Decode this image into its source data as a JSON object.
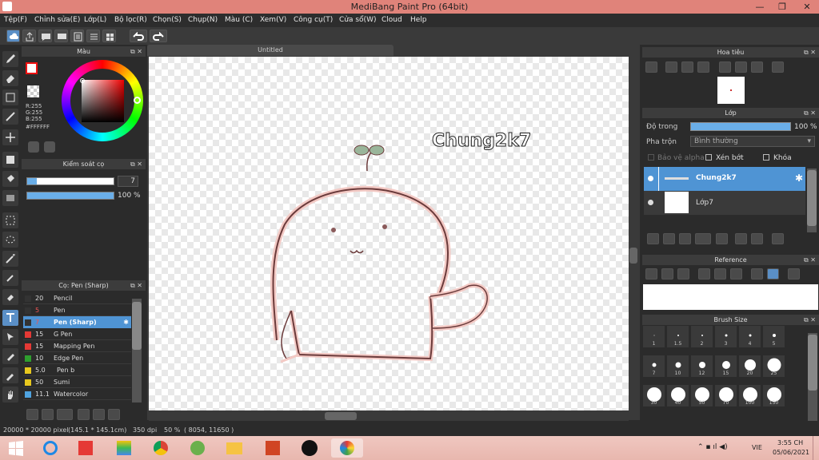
{
  "window": {
    "title": "MediBang Paint Pro (64bit)"
  },
  "menu": [
    "Tệp(F)",
    "Chỉnh sửa(E)",
    "Lớp(L)",
    "Bộ lọc(R)",
    "Chọn(S)",
    "Chụp(N)",
    "Màu (C)",
    "Xem(V)",
    "Công cụ(T)",
    "Cửa sổ(W)",
    "Cloud",
    "Help"
  ],
  "color_panel": {
    "title": "Màu",
    "r": "R:255",
    "g": "G:255",
    "b": "B:255",
    "hex": "#FFFFFF"
  },
  "brush_control": {
    "title": "Kiểm soát cọ",
    "size": "7",
    "opacity": "100 %"
  },
  "brush_list": {
    "title": "Cọ: Pen (Sharp)",
    "items": [
      {
        "size": "20",
        "name": "Pencil",
        "color": "#333333"
      },
      {
        "size": "5",
        "name": "Pen",
        "color": "#333333"
      },
      {
        "size": "7",
        "name": "Pen (Sharp)",
        "color": "#333333"
      },
      {
        "size": "15",
        "name": "G Pen",
        "color": "#e53935"
      },
      {
        "size": "15",
        "name": "Mapping Pen",
        "color": "#e53935"
      },
      {
        "size": "10",
        "name": "Edge Pen",
        "color": "#2e9e2e"
      },
      {
        "size": "5.0",
        "name": "Pen b",
        "color": "#e8c81e"
      },
      {
        "size": "50",
        "name": "Sumi",
        "color": "#e8c81e"
      },
      {
        "size": "11.1",
        "name": "Watercolor",
        "color": "#4fa3e0"
      }
    ]
  },
  "document": {
    "tab": "Untitled",
    "canvas_text": "Chung2k7"
  },
  "navigator": {
    "title": "Hoa tiêu"
  },
  "layer_panel": {
    "title": "Lớp",
    "opacity_label": "Độ trong",
    "opacity_value": "100 %",
    "blend_label": "Pha trộn",
    "blend_value": "Bình thường",
    "protect_alpha": "Bảo vệ alpha",
    "clipping": "Xén bớt",
    "lock": "Khóa",
    "layers": [
      {
        "name": "Chung2k7",
        "selected": true
      },
      {
        "name": "Lớp7",
        "selected": false
      }
    ]
  },
  "reference": {
    "title": "Reference"
  },
  "brush_size": {
    "title": "Brush Size",
    "sizes": [
      "1",
      "1.5",
      "2",
      "3",
      "4",
      "5",
      "7",
      "10",
      "12",
      "15",
      "20",
      "25",
      "30",
      "40",
      "50",
      "70",
      "100",
      "150"
    ]
  },
  "status": {
    "dims": "20000 * 20000 pixel",
    "phys": "(145.1 * 145.1cm)",
    "dpi": "350 dpi",
    "zoom": "50 %",
    "coords": "( 8054, 11650 )"
  },
  "taskbar": {
    "lang": "VIE",
    "time": "3:55 CH",
    "date": "05/06/2021"
  }
}
